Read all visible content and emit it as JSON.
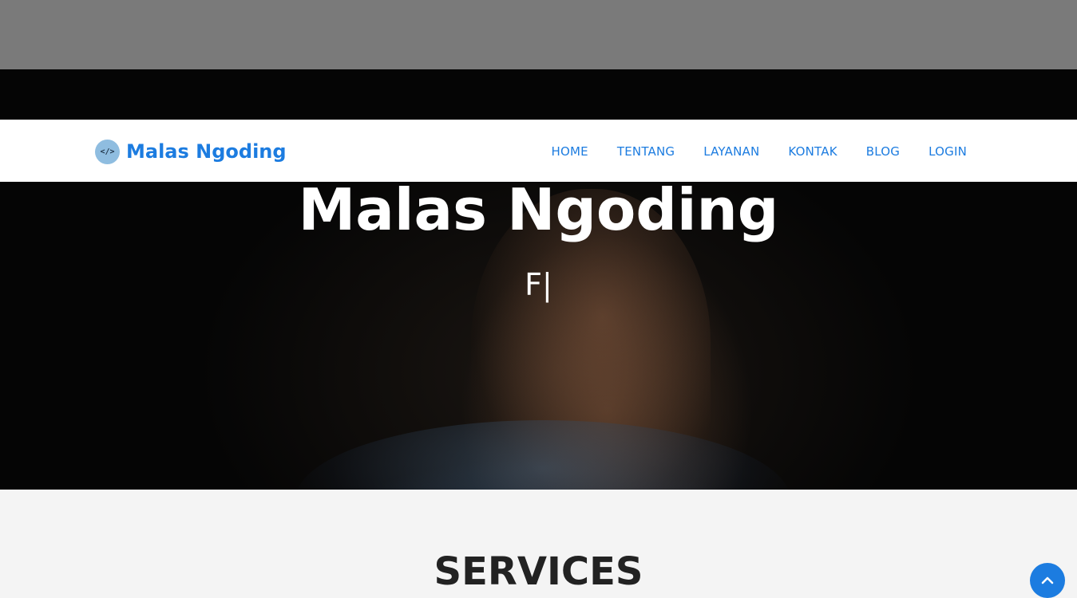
{
  "brand": {
    "logo_text": "</>",
    "name": "Malas Ngoding"
  },
  "nav": {
    "items": [
      {
        "label": "HOME"
      },
      {
        "label": "TENTANG"
      },
      {
        "label": "LAYANAN"
      },
      {
        "label": "KONTAK"
      },
      {
        "label": "BLOG"
      },
      {
        "label": "LOGIN"
      }
    ]
  },
  "hero": {
    "title": "Malas Ngoding",
    "typed_text": "F",
    "cursor": "|"
  },
  "services": {
    "title": "SERVICES"
  },
  "back_to_top": {
    "icon": "chevron-up-icon"
  },
  "colors": {
    "accent": "#1c7ce0",
    "navbar_bg": "#ffffff",
    "top_bar": "#7a7a7a",
    "page_bg": "#f4f4f4"
  }
}
